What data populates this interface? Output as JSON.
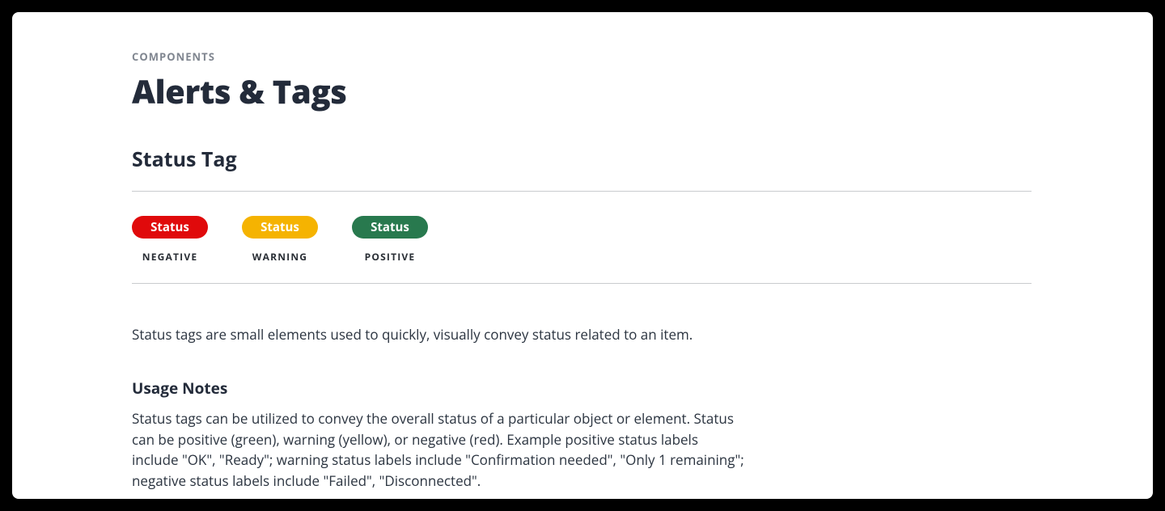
{
  "header": {
    "eyebrow": "COMPONENTS",
    "title": "Alerts & Tags"
  },
  "section": {
    "title": "Status Tag"
  },
  "examples": [
    {
      "pill_text": "Status",
      "label": "NEGATIVE",
      "variant": "negative"
    },
    {
      "pill_text": "Status",
      "label": "WARNING",
      "variant": "warning"
    },
    {
      "pill_text": "Status",
      "label": "POSITIVE",
      "variant": "positive"
    }
  ],
  "description": "Status tags are small elements used to quickly, visually convey status related to an item.",
  "usage": {
    "title": "Usage Notes",
    "body": "Status tags can be utilized to convey the overall status of a particular object or element. Status can be positive (green), warning (yellow), or negative (red). Example positive status labels include \"OK\", \"Ready\"; warning status labels include \"Confirmation needed\", \"Only 1 remaining\"; negative status labels include \"Failed\", \"Disconnected\"."
  },
  "colors": {
    "negative": "#e00a0b",
    "warning": "#f5b301",
    "positive": "#28794e"
  }
}
